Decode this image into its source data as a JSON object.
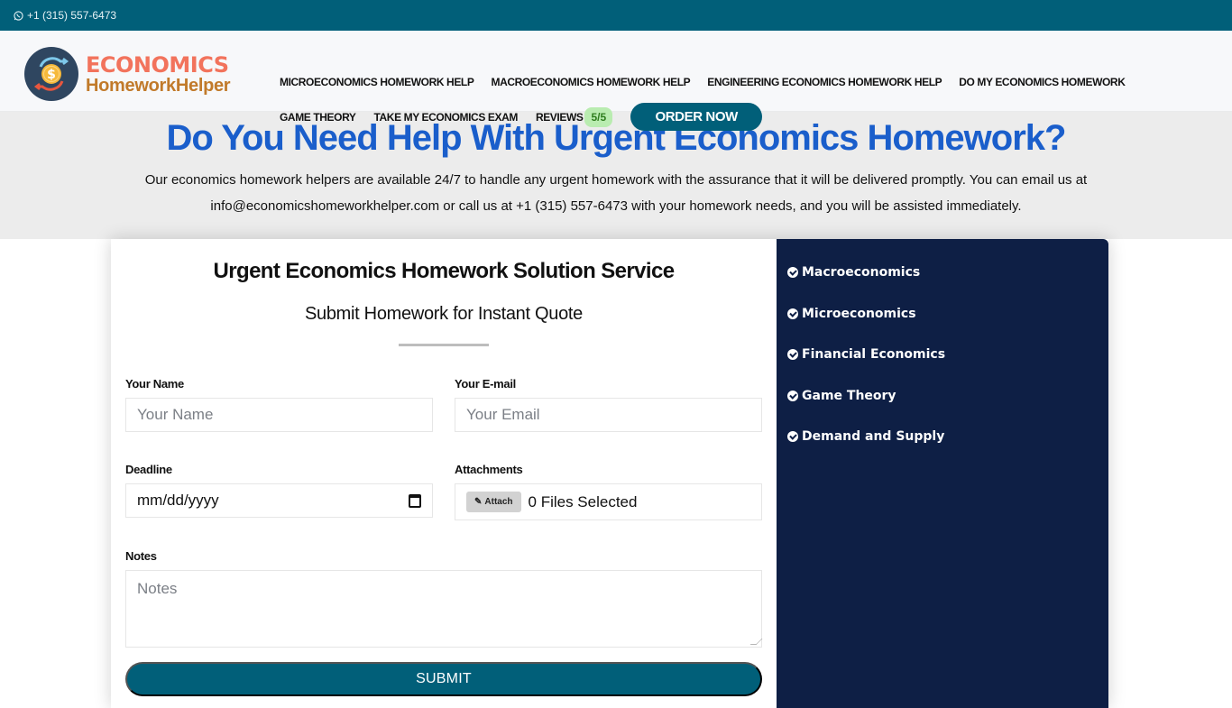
{
  "topbar": {
    "contact_icon": "whatsapp-icon",
    "phone": "+1 (315) 557-6473"
  },
  "brand": {
    "logo_icon": "dollar-coin-exchange-icon",
    "line1": "ECONOMICS",
    "line2": "HomeworkHelper",
    "colors": {
      "line1": "#f2735c",
      "line2": "#c17a2a",
      "primary": "#015f79",
      "sidebar": "#0e1f45",
      "heading": "#1a5ecb"
    }
  },
  "nav": {
    "row1": [
      "MICROECONOMICS HOMEWORK HELP",
      "MACROECONOMICS HOMEWORK HELP",
      "ENGINEERING ECONOMICS HOMEWORK HELP",
      "DO MY ECONOMICS HOMEWORK"
    ],
    "row2": [
      "GAME THEORY",
      "TAKE MY ECONOMICS EXAM"
    ],
    "reviews_label": "REVIEWS",
    "reviews_badge": "5/5",
    "order_label": "ORDER NOW"
  },
  "hero": {
    "title": "Do You Need Help With Urgent Economics Homework?",
    "text": "Our economics homework helpers are available 24/7 to handle any urgent homework with the assurance that it will be delivered promptly. You can email us at info@economicshomeworkhelper.com or call us at +1 (315) 557-6473 with your homework needs, and you will be assisted immediately."
  },
  "form": {
    "title": "Urgent Economics Homework Solution Service",
    "subtitle": "Submit Homework for Instant Quote",
    "name_label": "Your Name",
    "name_placeholder": "Your Name",
    "email_label": "Your E-mail",
    "email_placeholder": "Your Email",
    "deadline_label": "Deadline",
    "deadline_value": "mm/dd/yyyy",
    "attachments_label": "Attachments",
    "attach_button": "Attach",
    "attach_status": "0 Files Selected",
    "notes_label": "Notes",
    "notes_placeholder": "Notes",
    "submit_label": "SUBMIT"
  },
  "sidebar": {
    "items": [
      "Macroeconomics",
      "Microeconomics",
      "Financial Economics",
      "Game Theory",
      "Demand and Supply"
    ]
  }
}
